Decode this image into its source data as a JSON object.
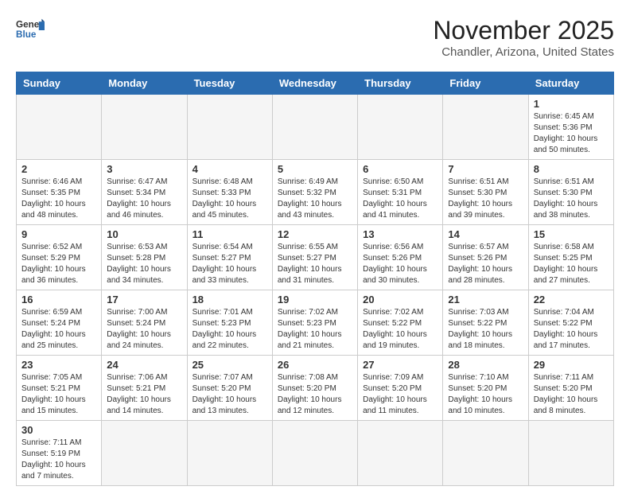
{
  "logo": {
    "line1": "General",
    "line2": "Blue"
  },
  "title": "November 2025",
  "subtitle": "Chandler, Arizona, United States",
  "weekdays": [
    "Sunday",
    "Monday",
    "Tuesday",
    "Wednesday",
    "Thursday",
    "Friday",
    "Saturday"
  ],
  "weeks": [
    [
      {
        "day": "",
        "sunrise": "",
        "sunset": "",
        "daylight": ""
      },
      {
        "day": "",
        "sunrise": "",
        "sunset": "",
        "daylight": ""
      },
      {
        "day": "",
        "sunrise": "",
        "sunset": "",
        "daylight": ""
      },
      {
        "day": "",
        "sunrise": "",
        "sunset": "",
        "daylight": ""
      },
      {
        "day": "",
        "sunrise": "",
        "sunset": "",
        "daylight": ""
      },
      {
        "day": "",
        "sunrise": "",
        "sunset": "",
        "daylight": ""
      },
      {
        "day": "1",
        "sunrise": "Sunrise: 6:45 AM",
        "sunset": "Sunset: 5:36 PM",
        "daylight": "Daylight: 10 hours and 50 minutes."
      }
    ],
    [
      {
        "day": "2",
        "sunrise": "Sunrise: 6:46 AM",
        "sunset": "Sunset: 5:35 PM",
        "daylight": "Daylight: 10 hours and 48 minutes."
      },
      {
        "day": "3",
        "sunrise": "Sunrise: 6:47 AM",
        "sunset": "Sunset: 5:34 PM",
        "daylight": "Daylight: 10 hours and 46 minutes."
      },
      {
        "day": "4",
        "sunrise": "Sunrise: 6:48 AM",
        "sunset": "Sunset: 5:33 PM",
        "daylight": "Daylight: 10 hours and 45 minutes."
      },
      {
        "day": "5",
        "sunrise": "Sunrise: 6:49 AM",
        "sunset": "Sunset: 5:32 PM",
        "daylight": "Daylight: 10 hours and 43 minutes."
      },
      {
        "day": "6",
        "sunrise": "Sunrise: 6:50 AM",
        "sunset": "Sunset: 5:31 PM",
        "daylight": "Daylight: 10 hours and 41 minutes."
      },
      {
        "day": "7",
        "sunrise": "Sunrise: 6:51 AM",
        "sunset": "Sunset: 5:30 PM",
        "daylight": "Daylight: 10 hours and 39 minutes."
      },
      {
        "day": "8",
        "sunrise": "Sunrise: 6:51 AM",
        "sunset": "Sunset: 5:30 PM",
        "daylight": "Daylight: 10 hours and 38 minutes."
      }
    ],
    [
      {
        "day": "9",
        "sunrise": "Sunrise: 6:52 AM",
        "sunset": "Sunset: 5:29 PM",
        "daylight": "Daylight: 10 hours and 36 minutes."
      },
      {
        "day": "10",
        "sunrise": "Sunrise: 6:53 AM",
        "sunset": "Sunset: 5:28 PM",
        "daylight": "Daylight: 10 hours and 34 minutes."
      },
      {
        "day": "11",
        "sunrise": "Sunrise: 6:54 AM",
        "sunset": "Sunset: 5:27 PM",
        "daylight": "Daylight: 10 hours and 33 minutes."
      },
      {
        "day": "12",
        "sunrise": "Sunrise: 6:55 AM",
        "sunset": "Sunset: 5:27 PM",
        "daylight": "Daylight: 10 hours and 31 minutes."
      },
      {
        "day": "13",
        "sunrise": "Sunrise: 6:56 AM",
        "sunset": "Sunset: 5:26 PM",
        "daylight": "Daylight: 10 hours and 30 minutes."
      },
      {
        "day": "14",
        "sunrise": "Sunrise: 6:57 AM",
        "sunset": "Sunset: 5:26 PM",
        "daylight": "Daylight: 10 hours and 28 minutes."
      },
      {
        "day": "15",
        "sunrise": "Sunrise: 6:58 AM",
        "sunset": "Sunset: 5:25 PM",
        "daylight": "Daylight: 10 hours and 27 minutes."
      }
    ],
    [
      {
        "day": "16",
        "sunrise": "Sunrise: 6:59 AM",
        "sunset": "Sunset: 5:24 PM",
        "daylight": "Daylight: 10 hours and 25 minutes."
      },
      {
        "day": "17",
        "sunrise": "Sunrise: 7:00 AM",
        "sunset": "Sunset: 5:24 PM",
        "daylight": "Daylight: 10 hours and 24 minutes."
      },
      {
        "day": "18",
        "sunrise": "Sunrise: 7:01 AM",
        "sunset": "Sunset: 5:23 PM",
        "daylight": "Daylight: 10 hours and 22 minutes."
      },
      {
        "day": "19",
        "sunrise": "Sunrise: 7:02 AM",
        "sunset": "Sunset: 5:23 PM",
        "daylight": "Daylight: 10 hours and 21 minutes."
      },
      {
        "day": "20",
        "sunrise": "Sunrise: 7:02 AM",
        "sunset": "Sunset: 5:22 PM",
        "daylight": "Daylight: 10 hours and 19 minutes."
      },
      {
        "day": "21",
        "sunrise": "Sunrise: 7:03 AM",
        "sunset": "Sunset: 5:22 PM",
        "daylight": "Daylight: 10 hours and 18 minutes."
      },
      {
        "day": "22",
        "sunrise": "Sunrise: 7:04 AM",
        "sunset": "Sunset: 5:22 PM",
        "daylight": "Daylight: 10 hours and 17 minutes."
      }
    ],
    [
      {
        "day": "23",
        "sunrise": "Sunrise: 7:05 AM",
        "sunset": "Sunset: 5:21 PM",
        "daylight": "Daylight: 10 hours and 15 minutes."
      },
      {
        "day": "24",
        "sunrise": "Sunrise: 7:06 AM",
        "sunset": "Sunset: 5:21 PM",
        "daylight": "Daylight: 10 hours and 14 minutes."
      },
      {
        "day": "25",
        "sunrise": "Sunrise: 7:07 AM",
        "sunset": "Sunset: 5:20 PM",
        "daylight": "Daylight: 10 hours and 13 minutes."
      },
      {
        "day": "26",
        "sunrise": "Sunrise: 7:08 AM",
        "sunset": "Sunset: 5:20 PM",
        "daylight": "Daylight: 10 hours and 12 minutes."
      },
      {
        "day": "27",
        "sunrise": "Sunrise: 7:09 AM",
        "sunset": "Sunset: 5:20 PM",
        "daylight": "Daylight: 10 hours and 11 minutes."
      },
      {
        "day": "28",
        "sunrise": "Sunrise: 7:10 AM",
        "sunset": "Sunset: 5:20 PM",
        "daylight": "Daylight: 10 hours and 10 minutes."
      },
      {
        "day": "29",
        "sunrise": "Sunrise: 7:11 AM",
        "sunset": "Sunset: 5:20 PM",
        "daylight": "Daylight: 10 hours and 8 minutes."
      }
    ],
    [
      {
        "day": "30",
        "sunrise": "Sunrise: 7:11 AM",
        "sunset": "Sunset: 5:19 PM",
        "daylight": "Daylight: 10 hours and 7 minutes."
      },
      {
        "day": "",
        "sunrise": "",
        "sunset": "",
        "daylight": ""
      },
      {
        "day": "",
        "sunrise": "",
        "sunset": "",
        "daylight": ""
      },
      {
        "day": "",
        "sunrise": "",
        "sunset": "",
        "daylight": ""
      },
      {
        "day": "",
        "sunrise": "",
        "sunset": "",
        "daylight": ""
      },
      {
        "day": "",
        "sunrise": "",
        "sunset": "",
        "daylight": ""
      },
      {
        "day": "",
        "sunrise": "",
        "sunset": "",
        "daylight": ""
      }
    ]
  ]
}
